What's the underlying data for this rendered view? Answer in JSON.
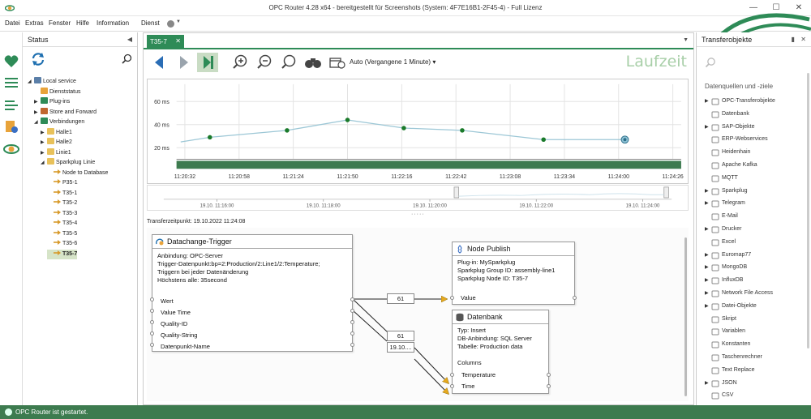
{
  "window": {
    "title": "OPC Router 4.28 x64 - bereitgestellt für Screenshots (System: 4F7E16B1-2F45-4) - Full Lizenz",
    "minimize_icon": "minimize-icon",
    "maximize_icon": "maximize-icon",
    "close_icon": "close-icon"
  },
  "menu": {
    "items": [
      "Datei",
      "Extras",
      "Fenster",
      "Hilfe",
      "Information",
      "Dienst"
    ]
  },
  "status_panel": {
    "title": "Status",
    "tree": [
      {
        "label": "Local service",
        "level": 0,
        "twisty": "open",
        "icon": "computer-icon"
      },
      {
        "label": "Dienststatus",
        "level": 1,
        "twisty": "",
        "icon": "service-status-icon"
      },
      {
        "label": "Plug-ins",
        "level": 1,
        "twisty": "closed",
        "icon": "plugin-icon"
      },
      {
        "label": "Store and Forward",
        "level": 1,
        "twisty": "closed",
        "icon": "store-forward-icon"
      },
      {
        "label": "Verbindungen",
        "level": 1,
        "twisty": "open",
        "icon": "connections-icon"
      },
      {
        "label": "Halle1",
        "level": 2,
        "twisty": "closed",
        "icon": "folder-icon"
      },
      {
        "label": "Halle2",
        "level": 2,
        "twisty": "closed",
        "icon": "folder-icon"
      },
      {
        "label": "Linie1",
        "level": 2,
        "twisty": "closed",
        "icon": "folder-icon"
      },
      {
        "label": "Sparkplug Linie",
        "level": 2,
        "twisty": "open",
        "icon": "folder-open-icon"
      },
      {
        "label": "Node to Database",
        "level": 3,
        "twisty": "",
        "icon": "connection-icon"
      },
      {
        "label": "P35-1",
        "level": 3,
        "twisty": "",
        "icon": "connection-icon"
      },
      {
        "label": "T35-1",
        "level": 3,
        "twisty": "",
        "icon": "connection-icon"
      },
      {
        "label": "T35-2",
        "level": 3,
        "twisty": "",
        "icon": "connection-icon"
      },
      {
        "label": "T35-3",
        "level": 3,
        "twisty": "",
        "icon": "connection-icon"
      },
      {
        "label": "T35-4",
        "level": 3,
        "twisty": "",
        "icon": "connection-icon"
      },
      {
        "label": "T35-5",
        "level": 3,
        "twisty": "",
        "icon": "connection-icon"
      },
      {
        "label": "T35-6",
        "level": 3,
        "twisty": "",
        "icon": "connection-icon"
      },
      {
        "label": "T35-7",
        "level": 3,
        "twisty": "",
        "icon": "connection-icon",
        "selected": true
      }
    ]
  },
  "document": {
    "tab_label": "T35-7",
    "toolbar": {
      "auto_label": "Auto (Vergangene 1 Minute)",
      "laufzeit_label": "Laufzeit"
    },
    "transfer_time_label": "Transferzeitpunkt:  19.10.2022 11:24:08"
  },
  "chart_data": {
    "type": "line",
    "ylabel": "",
    "y_ticks": [
      "20 ms",
      "40 ms",
      "60 ms"
    ],
    "ylim": [
      10,
      75
    ],
    "x_tick_labels": [
      "11:20:32",
      "11:20:58",
      "11:21:24",
      "11:21:50",
      "11:22:16",
      "11:22:42",
      "11:23:08",
      "11:23:34",
      "11:24:00",
      "11:24:26"
    ],
    "series": [
      {
        "x": [
          "11:20:30",
          "11:20:44",
          "11:21:21",
          "11:21:50",
          "11:22:17",
          "11:22:45",
          "11:23:24",
          "11:24:03"
        ],
        "values": [
          25,
          29,
          35,
          44,
          37,
          35,
          27,
          27
        ],
        "markers": [
          false,
          true,
          true,
          true,
          true,
          true,
          true,
          true
        ],
        "color": "#9cc7d6",
        "marker_color": "#1a7a2a"
      }
    ],
    "grid": true,
    "overview_tick_labels": [
      "19.10. 11:16:00",
      "19.10. 11:18:00",
      "19.10. 11:20:00",
      "19.10. 11:22:00",
      "19.10. 11:24:00"
    ]
  },
  "blocks": {
    "trigger": {
      "title": "Datachange-Trigger",
      "info": [
        "Anbindung: OPC-Server",
        "Trigger-Datenpunkt:bp=2:Production/2:Line1/2:Temperature;",
        "Triggern bei jeder Datenänderung",
        "Höchstens alle: 35second"
      ],
      "fields": [
        "Wert",
        "Value Time",
        "Quality-ID",
        "Quality-String",
        "Datenpunkt-Name"
      ]
    },
    "node_publish": {
      "title": "Node Publish",
      "info": [
        "Plug-in: MySparkplug",
        "Sparkplug Group ID: assembly-line1",
        "Sparkplug Node ID: T35-7"
      ],
      "fields": [
        "Value"
      ]
    },
    "datenbank": {
      "title": "Datenbank",
      "info": [
        "Typ: Insert",
        "DB-Anbindung: SQL Server",
        "Tabelle: Production data"
      ],
      "columns_label": "Columns",
      "fields": [
        "Temperature",
        "Time"
      ]
    },
    "connector_values": [
      "61",
      "61",
      "19.10...."
    ]
  },
  "transfer_panel": {
    "title": "Transferobjekte",
    "section_title": "Datenquellen und -ziele",
    "items": [
      {
        "label": "OPC-Transferobjekte",
        "arrow": true,
        "icon": "opc-icon"
      },
      {
        "label": "Datenbank",
        "arrow": false,
        "icon": "database-icon"
      },
      {
        "label": "SAP-Objekte",
        "arrow": true,
        "icon": "sap-icon"
      },
      {
        "label": "ERP-Webservices",
        "arrow": false,
        "icon": "erp-icon"
      },
      {
        "label": "Heidenhain",
        "arrow": false,
        "icon": "heidenhain-icon"
      },
      {
        "label": "Apache Kafka",
        "arrow": false,
        "icon": "kafka-icon"
      },
      {
        "label": "MQTT",
        "arrow": false,
        "icon": "mqtt-icon"
      },
      {
        "label": "Sparkplug",
        "arrow": true,
        "icon": "sparkplug-icon"
      },
      {
        "label": "Telegram",
        "arrow": true,
        "icon": "telegram-icon"
      },
      {
        "label": "E-Mail",
        "arrow": false,
        "icon": "email-icon"
      },
      {
        "label": "Drucker",
        "arrow": true,
        "icon": "printer-icon"
      },
      {
        "label": "Excel",
        "arrow": false,
        "icon": "excel-icon"
      },
      {
        "label": "Euromap77",
        "arrow": true,
        "icon": "euromap-icon"
      },
      {
        "label": "MongoDB",
        "arrow": true,
        "icon": "mongodb-icon"
      },
      {
        "label": "InfluxDB",
        "arrow": true,
        "icon": "influxdb-icon"
      },
      {
        "label": "Network File Access",
        "arrow": true,
        "icon": "network-file-icon"
      },
      {
        "label": "Datei-Objekte",
        "arrow": true,
        "icon": "file-objects-icon"
      },
      {
        "label": "Skript",
        "arrow": false,
        "icon": "script-icon"
      },
      {
        "label": "Variablen",
        "arrow": false,
        "icon": "variables-icon"
      },
      {
        "label": "Konstanten",
        "arrow": false,
        "icon": "constants-icon"
      },
      {
        "label": "Taschenrechner",
        "arrow": false,
        "icon": "calculator-icon"
      },
      {
        "label": "Text Replace",
        "arrow": false,
        "icon": "text-replace-icon"
      },
      {
        "label": "JSON",
        "arrow": true,
        "icon": "json-icon"
      },
      {
        "label": "CSV",
        "arrow": false,
        "icon": "csv-icon"
      }
    ]
  },
  "statusbar": {
    "text": "OPC Router ist gestartet."
  },
  "colors": {
    "accent": "#2e8b57",
    "statusbar": "#3d7b4f",
    "chart_bar": "#3d7b4f"
  }
}
